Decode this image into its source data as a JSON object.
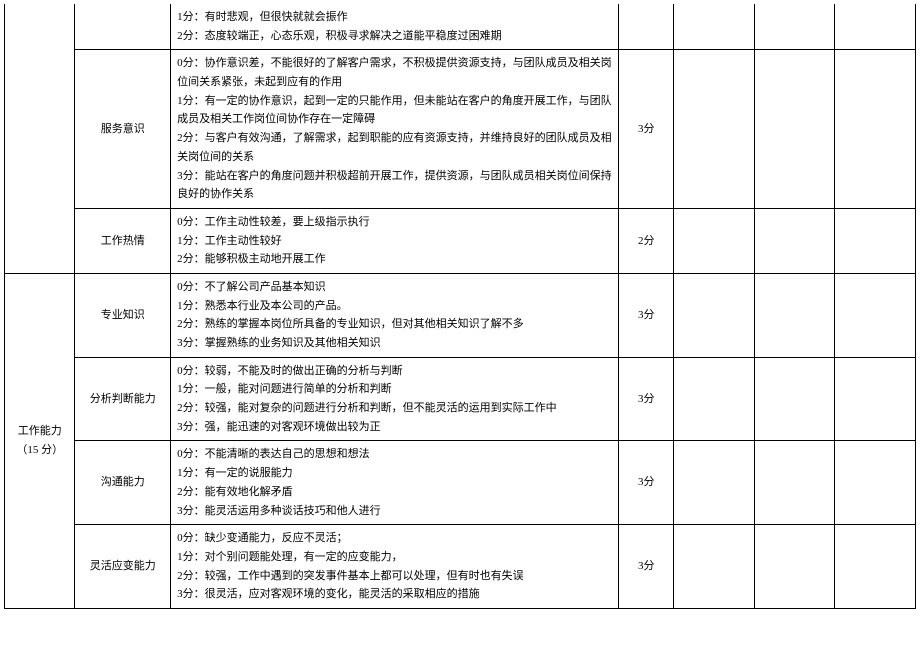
{
  "rows": [
    {
      "category": "",
      "categoryRowspan": 3,
      "item": "",
      "criteria": [
        "1分：有时悲观，但很快就就会振作",
        "2分：态度较端正，心态乐观，积极寻求解决之道能平稳度过困难期"
      ],
      "score": "",
      "firstRow": true,
      "noTopCat": true,
      "noTopItem": true,
      "noTopDesc": true,
      "noTopScore": true
    },
    {
      "item": "服务意识",
      "criteria": [
        "0分：协作意识差，不能很好的了解客户需求，不积极提供资源支持，与团队成员及相关岗位间关系紧张，未起到应有的作用",
        "1分：有一定的协作意识，起到一定的只能作用，但未能站在客户的角度开展工作，与团队成员及相关工作岗位间协作存在一定障碍",
        "2分：与客户有效沟通，了解需求，起到职能的应有资源支持，并维持良好的团队成员及相关岗位间的关系",
        "3分：能站在客户的角度问题并积极超前开展工作，提供资源，与团队成员相关岗位间保持良好的协作关系"
      ],
      "score": "3分"
    },
    {
      "item": "工作热情",
      "criteria": [
        "0分：工作主动性较差，要上级指示执行",
        "1分：工作主动性较好",
        "2分：能够积极主动地开展工作"
      ],
      "score": "2分"
    },
    {
      "category": "工作能力\n（15 分）",
      "categoryRowspan": 4,
      "item": "专业知识",
      "criteria": [
        "0分：不了解公司产品基本知识",
        "1分：熟悉本行业及本公司的产品。",
        "2分：熟练的掌握本岗位所具备的专业知识，但对其他相关知识了解不多",
        "3分：掌握熟练的业务知识及其他相关知识"
      ],
      "score": "3分",
      "firstRow": true
    },
    {
      "item": "分析判断能力",
      "criteria": [
        "0分：较弱，不能及时的做出正确的分析与判断",
        "1分：一般，能对问题进行简单的分析和判断",
        "2分：较强，能对复杂的问题进行分析和判断，但不能灵活的运用到实际工作中",
        "3分：强，能迅速的对客观环境做出较为正"
      ],
      "score": "3分"
    },
    {
      "item": "沟通能力",
      "criteria": [
        "0分：不能清晰的表达自己的思想和想法",
        "1分：有一定的说服能力",
        "2分：能有效地化解矛盾",
        "3分：能灵活运用多种谈话技巧和他人进行"
      ],
      "score": "3分"
    },
    {
      "item": "灵活应变能力",
      "criteria": [
        "0分：缺少变通能力，反应不灵活；",
        "1分：对个别问题能处理，有一定的应变能力，",
        "2分：较强，工作中遇到的突发事件基本上都可以处理，但有时也有失误",
        "3分：很灵活，应对客观环境的变化，能灵活的采取相应的措施"
      ],
      "score": "3分"
    }
  ]
}
